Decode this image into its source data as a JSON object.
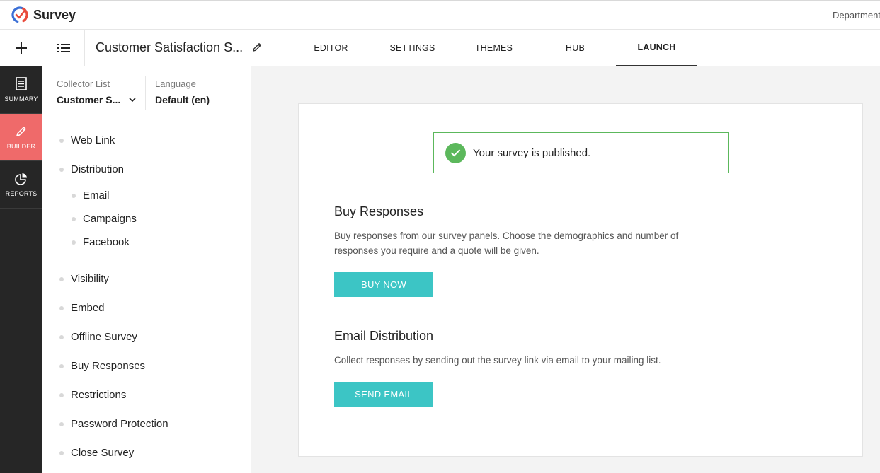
{
  "brand": {
    "name": "Survey",
    "department": "Department"
  },
  "toolbar": {
    "survey_title": "Customer Satisfaction S...",
    "tabs": [
      {
        "label": "EDITOR"
      },
      {
        "label": "SETTINGS"
      },
      {
        "label": "THEMES"
      },
      {
        "label": "HUB"
      },
      {
        "label": "LAUNCH",
        "active": true
      }
    ]
  },
  "sidebar": {
    "items": [
      {
        "label": "SUMMARY",
        "icon": "document-icon"
      },
      {
        "label": "BUILDER",
        "icon": "pencil-icon",
        "active": true
      },
      {
        "label": "REPORTS",
        "icon": "pie-chart-icon"
      }
    ]
  },
  "nav": {
    "collector_label": "Collector List",
    "collector_value": "Customer S...",
    "language_label": "Language",
    "language_value": "Default (en)",
    "items": [
      {
        "label": "Web Link"
      },
      {
        "label": "Distribution"
      },
      {
        "label": "Email"
      },
      {
        "label": "Campaigns"
      },
      {
        "label": "Facebook"
      },
      {
        "label": "Visibility"
      },
      {
        "label": "Embed"
      },
      {
        "label": "Offline Survey"
      },
      {
        "label": "Buy Responses"
      },
      {
        "label": "Restrictions"
      },
      {
        "label": "Password Protection"
      },
      {
        "label": "Close Survey"
      }
    ]
  },
  "main": {
    "published_message": "Your survey is published.",
    "buy": {
      "title": "Buy Responses",
      "description": "Buy responses from our survey panels. Choose the demographics and number of responses you require and a quote will be given.",
      "button": "BUY NOW"
    },
    "email": {
      "title": "Email Distribution",
      "description": "Collect responses by sending out the survey link via email to your mailing list.",
      "button": "SEND EMAIL"
    }
  },
  "colors": {
    "accent_teal": "#3cc5c5",
    "builder_red": "#ef6a6a",
    "success_green": "#5cb85c",
    "sidebar_dark": "#262626"
  }
}
